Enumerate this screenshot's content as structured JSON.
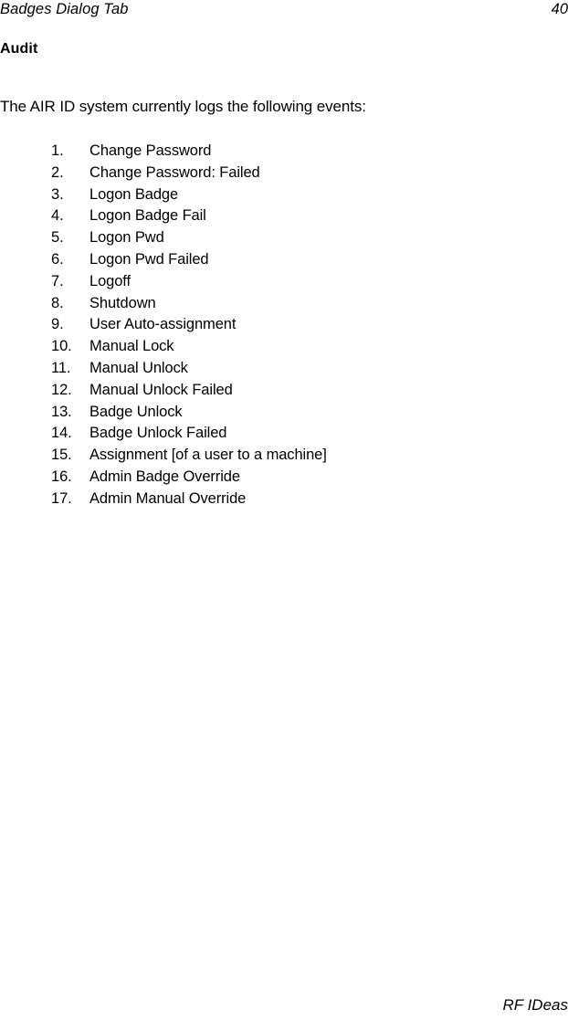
{
  "header": {
    "running_title": "Badges Dialog Tab",
    "page_number": "40"
  },
  "content": {
    "section_heading": "Audit",
    "intro_paragraph": "The AIR ID system currently logs the following events:",
    "events": [
      {
        "number": "1.",
        "label": "Change Password"
      },
      {
        "number": "2.",
        "label": "Change Password: Failed"
      },
      {
        "number": "3.",
        "label": "Logon Badge"
      },
      {
        "number": "4.",
        "label": "Logon Badge Fail"
      },
      {
        "number": "5.",
        "label": "Logon Pwd"
      },
      {
        "number": "6.",
        "label": "Logon Pwd Failed"
      },
      {
        "number": "7.",
        "label": "Logoff"
      },
      {
        "number": "8.",
        "label": "Shutdown"
      },
      {
        "number": "9.",
        "label": "User Auto-assignment"
      },
      {
        "number": "10.",
        "label": "Manual Lock"
      },
      {
        "number": "11.",
        "label": "Manual Unlock"
      },
      {
        "number": "12.",
        "label": "Manual Unlock Failed"
      },
      {
        "number": "13.",
        "label": "Badge Unlock"
      },
      {
        "number": "14.",
        "label": "Badge Unlock Failed"
      },
      {
        "number": "15.",
        "label": "Assignment [of a user to a machine]"
      },
      {
        "number": "16.",
        "label": "Admin Badge Override"
      },
      {
        "number": "17.",
        "label": "Admin Manual Override"
      }
    ]
  },
  "footer": {
    "brand": "RF IDeas"
  },
  "colors": {
    "page_background": "#ffffff",
    "text": "#000000"
  }
}
